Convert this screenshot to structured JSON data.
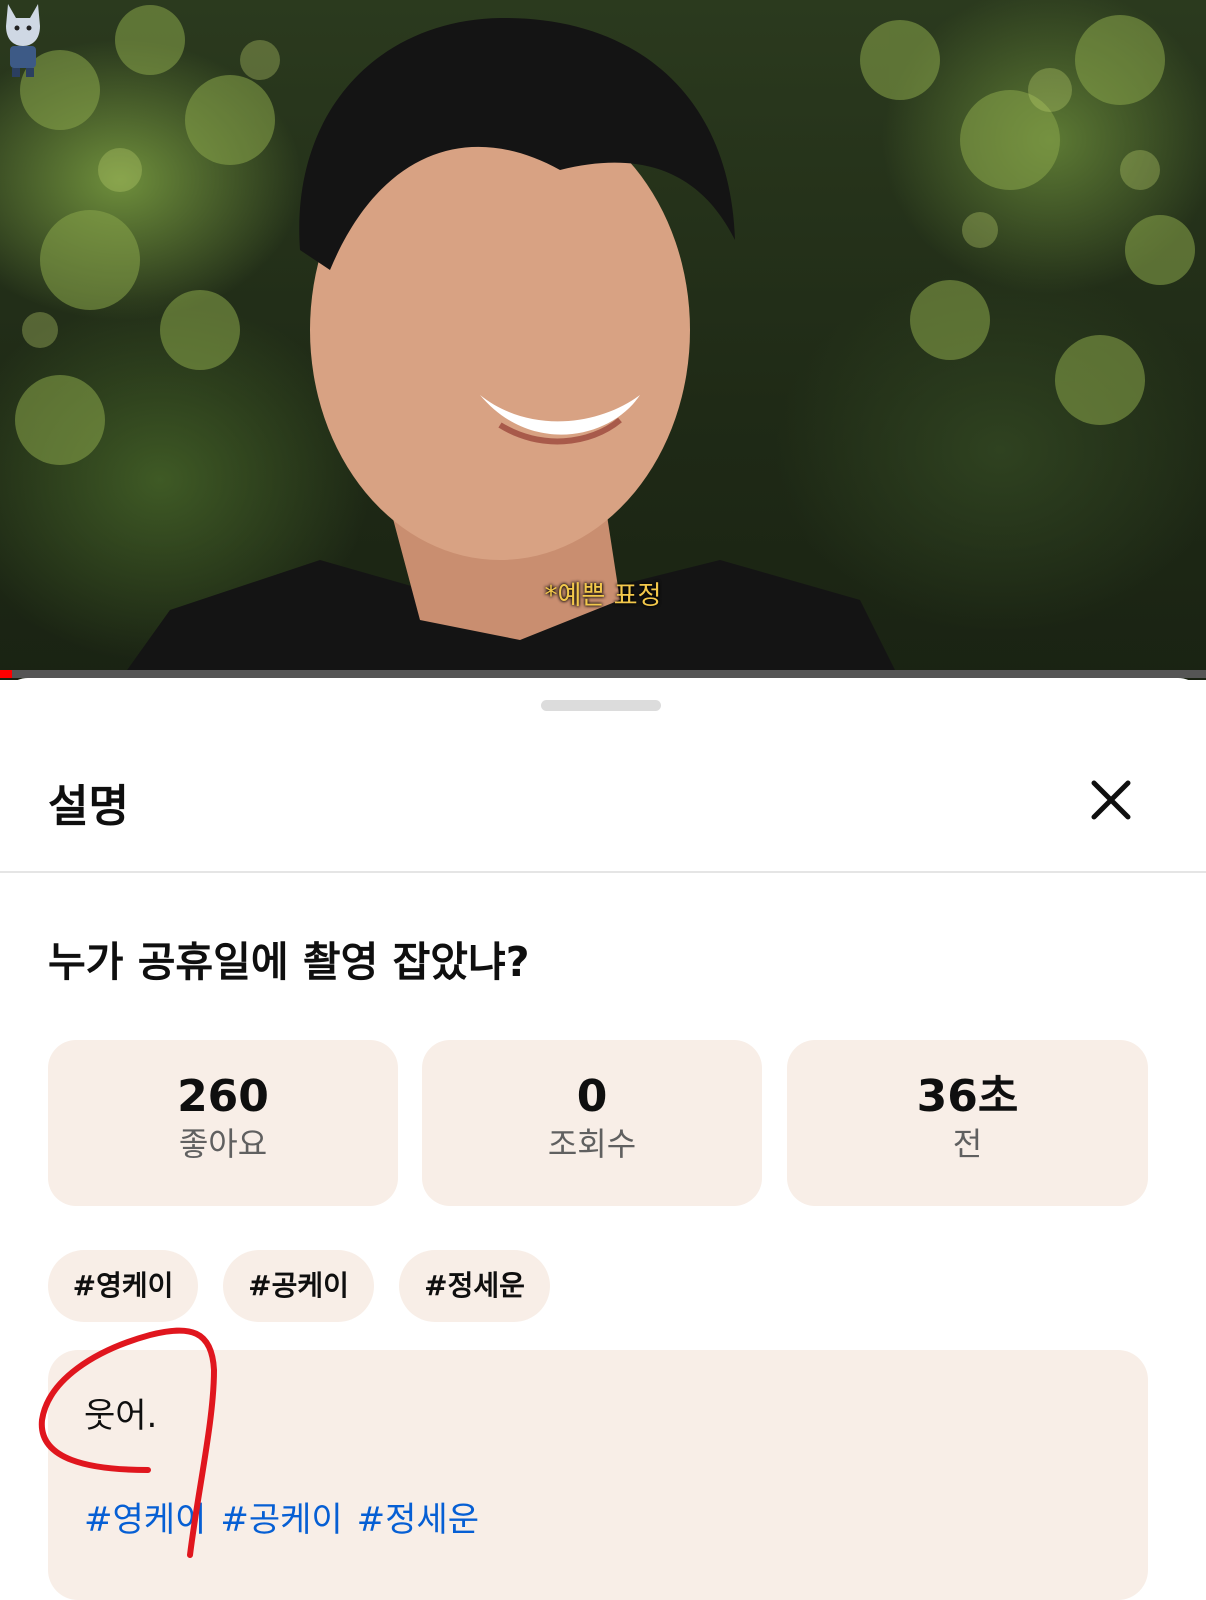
{
  "video": {
    "subtitle": "*예쁜 표정",
    "progress_fraction": 0.01
  },
  "sheet": {
    "title": "설명",
    "close_label": "close"
  },
  "main": {
    "video_title": "누가 공휴일에 촬영 잡았냐?",
    "stats": [
      {
        "value": "260",
        "label": "좋아요"
      },
      {
        "value": "0",
        "label": "조회수"
      },
      {
        "value": "36초",
        "label": "전"
      }
    ],
    "chips": [
      "#영케이",
      "#공케이",
      "#정세운"
    ],
    "description": {
      "text": "웃어.",
      "hashtags": [
        "#영케이",
        "#공케이",
        "#정세운"
      ]
    }
  },
  "colors": {
    "accent_red": "#ff0000",
    "card_bg": "#f8eee7",
    "link_blue": "#065fd4",
    "annotation_red": "#e0161e"
  }
}
